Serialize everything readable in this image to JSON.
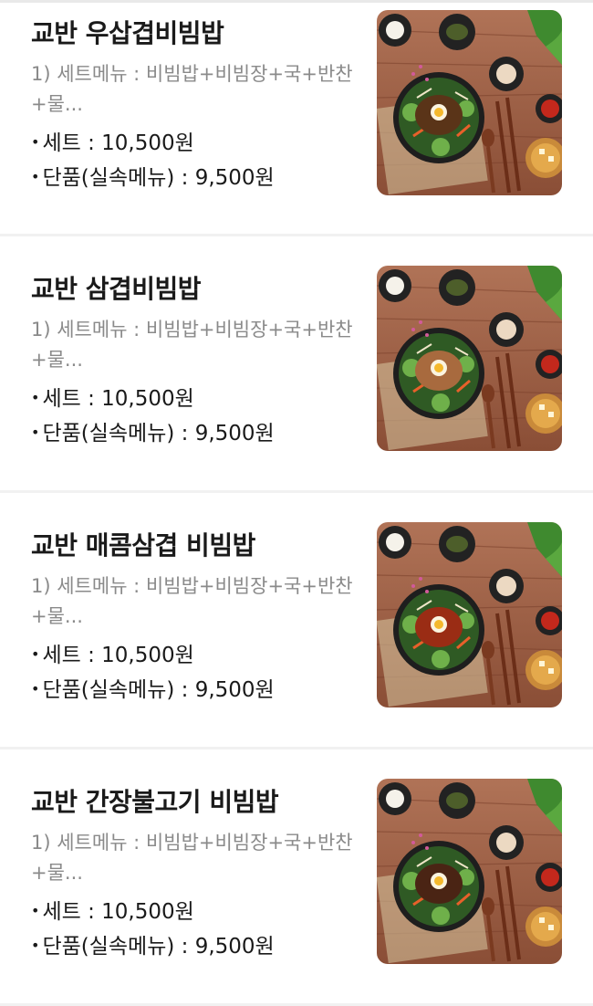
{
  "menu": {
    "items": [
      {
        "name": "교반 우삽겹비빔밥",
        "desc": "1) 세트메뉴 : 비빔밥+비빔장+국+반찬+물...",
        "set_price": "세트 : 10,500원",
        "single_price": "단품(실속메뉴) : 9,500원",
        "topping_color": "#5a3418"
      },
      {
        "name": "교반 삼겹비빔밥",
        "desc": "1) 세트메뉴 : 비빔밥+비빔장+국+반찬+물...",
        "set_price": "세트 : 10,500원",
        "single_price": "단품(실속메뉴) : 9,500원",
        "topping_color": "#a86a3e"
      },
      {
        "name": "교반 매콤삼겹 비빔밥",
        "desc": "1) 세트메뉴 : 비빔밥+비빔장+국+반찬+물...",
        "set_price": "세트 : 10,500원",
        "single_price": "단품(실속메뉴) : 9,500원",
        "topping_color": "#9a2c14"
      },
      {
        "name": "교반 간장불고기 비빔밥",
        "desc": "1) 세트메뉴 : 비빔밥+비빔장+국+반찬+물...",
        "set_price": "세트 : 10,500원",
        "single_price": "단품(실속메뉴) : 9,500원",
        "topping_color": "#4a2414"
      }
    ],
    "bullet": "•"
  }
}
